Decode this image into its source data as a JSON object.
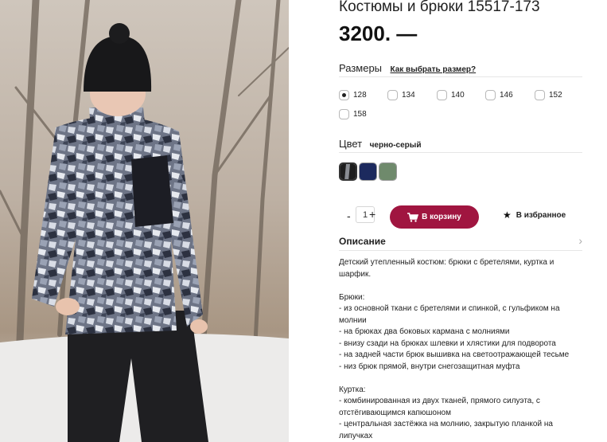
{
  "product": {
    "title": "Костюмы и брюки 15517-173",
    "price": "3200. —"
  },
  "sizes": {
    "label": "Размеры",
    "how_to_choose": "Как выбрать размер?",
    "options": [
      "128",
      "134",
      "140",
      "146",
      "152",
      "158"
    ],
    "selected": "128"
  },
  "color": {
    "label": "Цвет",
    "value": "черно-серый",
    "swatches": [
      "#1e1e1e",
      "#1c2a5e",
      "#6f8a6c"
    ]
  },
  "quantity": {
    "minus": "-",
    "value": "1",
    "plus": "+"
  },
  "actions": {
    "cart_label": "В корзину",
    "favorite_label": "В избранное",
    "cart_color": "#a01540"
  },
  "description": {
    "label": "Описание",
    "intro": "Детский утепленный костюм: брюки с бретелями, куртка и шарфик.",
    "pants_title": "Брюки:",
    "pants_items": [
      "- из основной ткани с бретелями и спинкой, с гульфиком на молнии",
      "- на брюках два боковых кармана с молниями",
      "- внизу сзади на брюках шлевки и хлястики для подворота",
      "- на задней части брюк вышивка на светоотражающей тесьме",
      "- низ брюк прямой, внутри снегозащитная муфта"
    ],
    "jacket_title": "Куртка:",
    "jacket_items": [
      "- комбинированная из двух тканей, прямого силуэта, с отстёгивающимся капюшоном",
      "- центральная застёжка на молнию, закрытую планкой на липучках"
    ]
  },
  "icons": {
    "cart": "cart-icon",
    "favorite": "star-icon",
    "expand": "chevron-right-icon"
  }
}
